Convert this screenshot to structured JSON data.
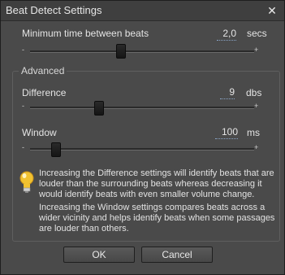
{
  "window": {
    "title": "Beat Detect Settings",
    "close_glyph": "✕"
  },
  "min_time": {
    "label": "Minimum time between beats",
    "value": "2,0",
    "unit": "secs",
    "min_marker": "-",
    "max_marker": "+",
    "level_fraction": 0.4
  },
  "advanced": {
    "legend": "Advanced",
    "difference": {
      "label": "Difference",
      "value": "9",
      "unit": "dbs",
      "min_marker": "-",
      "max_marker": "+",
      "level_fraction": 0.3
    },
    "window": {
      "label": "Window",
      "value": "100",
      "unit": "ms",
      "min_marker": "-",
      "max_marker": "+",
      "level_fraction": 0.1
    },
    "info_icon": "lightbulb-icon",
    "info_paragraph_1": "Increasing the Difference settings will identify beats that are louder than the surrounding beats whereas decreasing it would identify beats with even smaller volume change.",
    "info_paragraph_2": "Increasing the Window settings compares beats across a wider vicinity and helps identify beats when some passages are louder than others."
  },
  "buttons": {
    "ok": "OK",
    "cancel": "Cancel"
  },
  "colors": {
    "background": "#4a4a4a",
    "titlebar": "#3f3f3f",
    "text": "#e4e4e4",
    "bulb": "#f2c230"
  }
}
